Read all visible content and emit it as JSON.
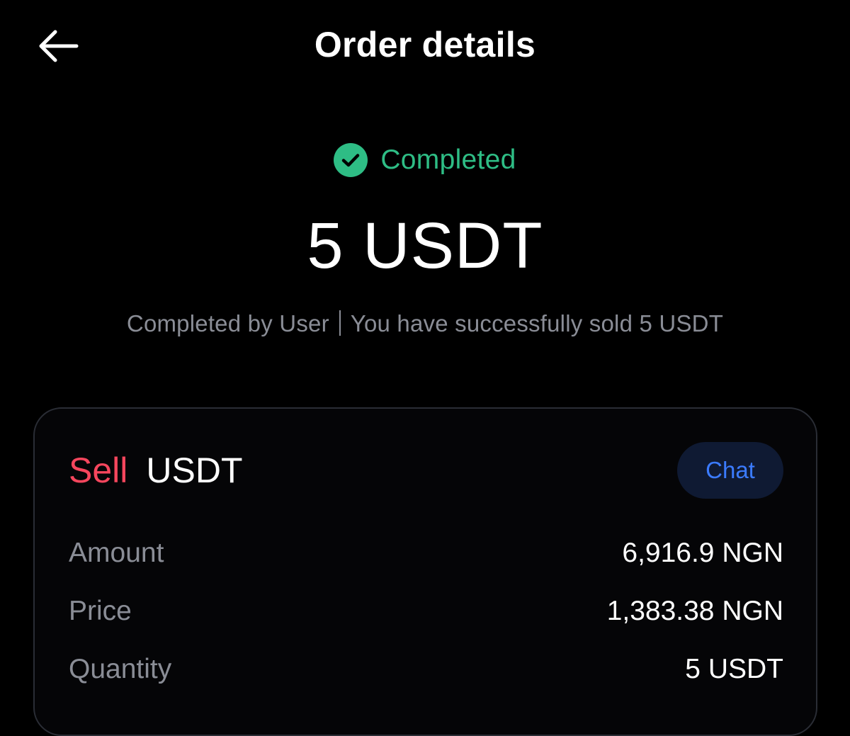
{
  "header": {
    "title": "Order details",
    "back_icon": "arrow-left-icon"
  },
  "status": {
    "icon": "check-circle-icon",
    "text": "Completed",
    "color": "#2ebd85"
  },
  "order": {
    "amount_display": "5 USDT",
    "completed_by": "Completed by User",
    "message": "You have successfully sold 5 USDT"
  },
  "card": {
    "side": "Sell",
    "side_color": "#f6465d",
    "asset": "USDT",
    "chat_label": "Chat",
    "rows": [
      {
        "label": "Amount",
        "value": "6,916.9 NGN"
      },
      {
        "label": "Price",
        "value": "1,383.38 NGN"
      },
      {
        "label": "Quantity",
        "value": "5 USDT"
      }
    ]
  }
}
